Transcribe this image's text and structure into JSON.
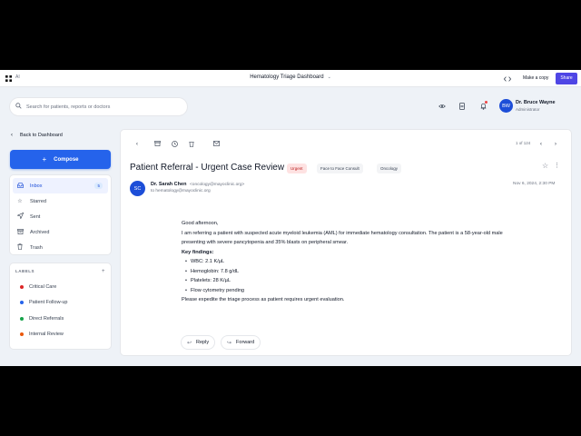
{
  "topbar": {
    "logo_icon": "grid-logo-icon",
    "ai_label": "AI",
    "title": "Hematology Triage Dashboard",
    "copy_label": "Make a copy",
    "share_label": "Share"
  },
  "search": {
    "placeholder": "Search for patients, reports or doctors"
  },
  "user": {
    "initials": "BW",
    "name": "Dr. Bruce Wayne",
    "role": "Administrator"
  },
  "sidebar": {
    "back_label": "Back to Dashboard",
    "compose_label": "Compose",
    "nav": [
      {
        "label": "Inbox",
        "count": "5",
        "icon": "inbox-icon"
      },
      {
        "label": "Starred",
        "icon": "star-icon"
      },
      {
        "label": "Sent",
        "icon": "send-icon"
      },
      {
        "label": "Archived",
        "icon": "archive-icon"
      },
      {
        "label": "Trash",
        "icon": "trash-icon"
      }
    ],
    "labels_title": "LABELS",
    "labels": [
      {
        "label": "Critical Care",
        "color": "#dc2626"
      },
      {
        "label": "Patient Follow-up",
        "color": "#2563eb"
      },
      {
        "label": "Direct Referrals",
        "color": "#16a34a"
      },
      {
        "label": "Internal Review",
        "color": "#ea580c"
      }
    ]
  },
  "email": {
    "pager": "1 of 124",
    "subject": "Patient Referral - Urgent Case Review",
    "tags": [
      "Urgent",
      "Face to Face Consult",
      "Oncology"
    ],
    "sender_initials": "SC",
    "sender_name": "Dr. Sarah Chen",
    "sender_email": "<oncology@mayoclinic.org>",
    "to": "to hematology@mayoclinic.org",
    "date": "Nov 6, 2024, 2:30 PM",
    "greeting": "Good afternoon,",
    "paragraph": "I am referring a patient with suspected acute myeloid leukemia (AML) for immediate hematology consultation. The patient is a 58-year-old male presenting with severe pancytopenia and 35% blasts on peripheral smear.",
    "key_findings_title": "Key findings:",
    "findings": [
      "WBC: 2.1 K/µL",
      "Hemoglobin: 7.8 g/dL",
      "Platelets: 28 K/µL",
      "Flow cytometry pending"
    ],
    "closing": "Please expedite the triage process as patient requires urgent evaluation.",
    "reply_label": "Reply",
    "forward_label": "Forward"
  },
  "colors": {
    "accent": "#2563eb",
    "share": "#4f46e5",
    "urgent_bg": "#fee2e2",
    "urgent_text": "#b91c1c"
  }
}
